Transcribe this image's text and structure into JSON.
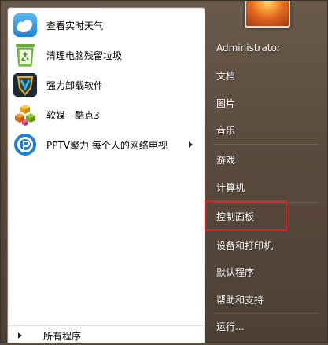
{
  "programs": [
    {
      "label": "查看实时天气",
      "icon": "weather-icon",
      "has_submenu": false
    },
    {
      "label": "清理电脑残留垃圾",
      "icon": "recycle-bin-icon",
      "has_submenu": false
    },
    {
      "label": "强力卸载软件",
      "icon": "uninstall-shield-icon",
      "has_submenu": false
    },
    {
      "label": "软媒 - 酷点3",
      "icon": "kudian-cubes-icon",
      "has_submenu": false
    },
    {
      "label": "PPTV聚力 每个人的网络电视",
      "icon": "pptv-icon",
      "has_submenu": true
    }
  ],
  "all_programs_label": "所有程序",
  "user_picture": "flower-user-picture",
  "right_items": [
    {
      "label": "Administrator"
    },
    {
      "label": "文档"
    },
    {
      "label": "图片"
    },
    {
      "label": "音乐"
    },
    {
      "label": "游戏"
    },
    {
      "label": "计算机"
    },
    {
      "label": "控制面板",
      "highlighted": true
    },
    {
      "label": "设备和打印机"
    },
    {
      "label": "默认程序"
    },
    {
      "label": "帮助和支持"
    },
    {
      "label": "运行..."
    }
  ],
  "colors": {
    "highlight_border": "#e02020",
    "menu_background": "#5a4a3d",
    "left_panel": "#ffffff"
  }
}
